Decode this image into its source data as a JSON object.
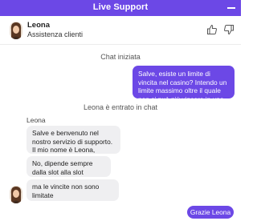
{
  "window": {
    "title": "Live Support"
  },
  "agent": {
    "name": "Leona",
    "role": "Assistenza clienti"
  },
  "chat": {
    "status_started": "Chat iniziata",
    "status_joined": "Leona è entrato in chat",
    "user_message": "Salve, esiste un limite di vincita nel casino? Intendo un limite massimo oltre il quale non si può più vincere in una singola giocata.",
    "agent_label": "Leona",
    "agent_messages": [
      "Salve e benvenuto nel nostro servizio di supporto. Il mio nome è Leona, piacere!",
      "No, dipende sempre dalla slot alla slot",
      "ma le vincite non sono limitate"
    ],
    "quick_reply": "Grazie Leona"
  },
  "colors": {
    "accent": "#6c48e6",
    "agent_bubble": "#efeff1"
  },
  "icons": {
    "minimize": "minimize-icon",
    "thumb_up": "thumbs-up-icon",
    "thumb_down": "thumbs-down-icon",
    "avatar": "agent-avatar"
  }
}
